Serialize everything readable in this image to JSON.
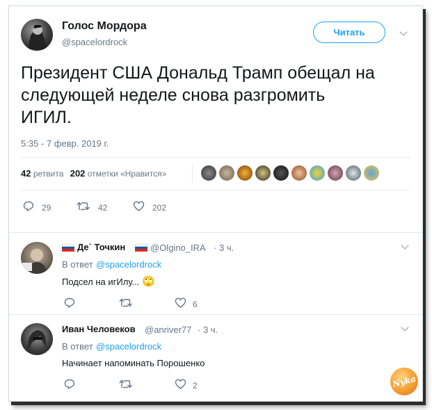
{
  "tweet": {
    "author_name": "Голос Мордора",
    "author_handle": "@spacelordrock",
    "follow_label": "Читать",
    "text_line1": "Президент США Дональд Трамп обещал на",
    "text_line2": "следующей неделе снова разгромить",
    "text_line3": "ИГИЛ.",
    "timestamp": "5:35 - 7 февр. 2019 г.",
    "retweets_count": "42",
    "retweets_label": "ретвита",
    "likes_count": "202",
    "likes_label": "отметки «Нравится»",
    "actions": {
      "reply": "29",
      "retweet": "42",
      "like": "202"
    }
  },
  "replies": [
    {
      "name": "Де` Точкин",
      "handle": "@Olgino_IRA",
      "time": "· 3 ч.",
      "reply_to_prefix": "В ответ",
      "reply_to_handle": "@spacelordrock",
      "text": "Подсел на игИлу...",
      "emoji": "🙄",
      "like_count": "6"
    },
    {
      "name": "Иван Человеков",
      "handle": "@anriver77",
      "time": "· 3 ч.",
      "reply_to_prefix": "В ответ",
      "reply_to_handle": "@spacelordrock",
      "text": "Начинает напоминать Порошенко",
      "like_count": "2"
    }
  ],
  "watermark": "Nyka",
  "colors": {
    "accent": "#1da1f2",
    "muted": "#657786",
    "divider": "#e6ecf0"
  }
}
